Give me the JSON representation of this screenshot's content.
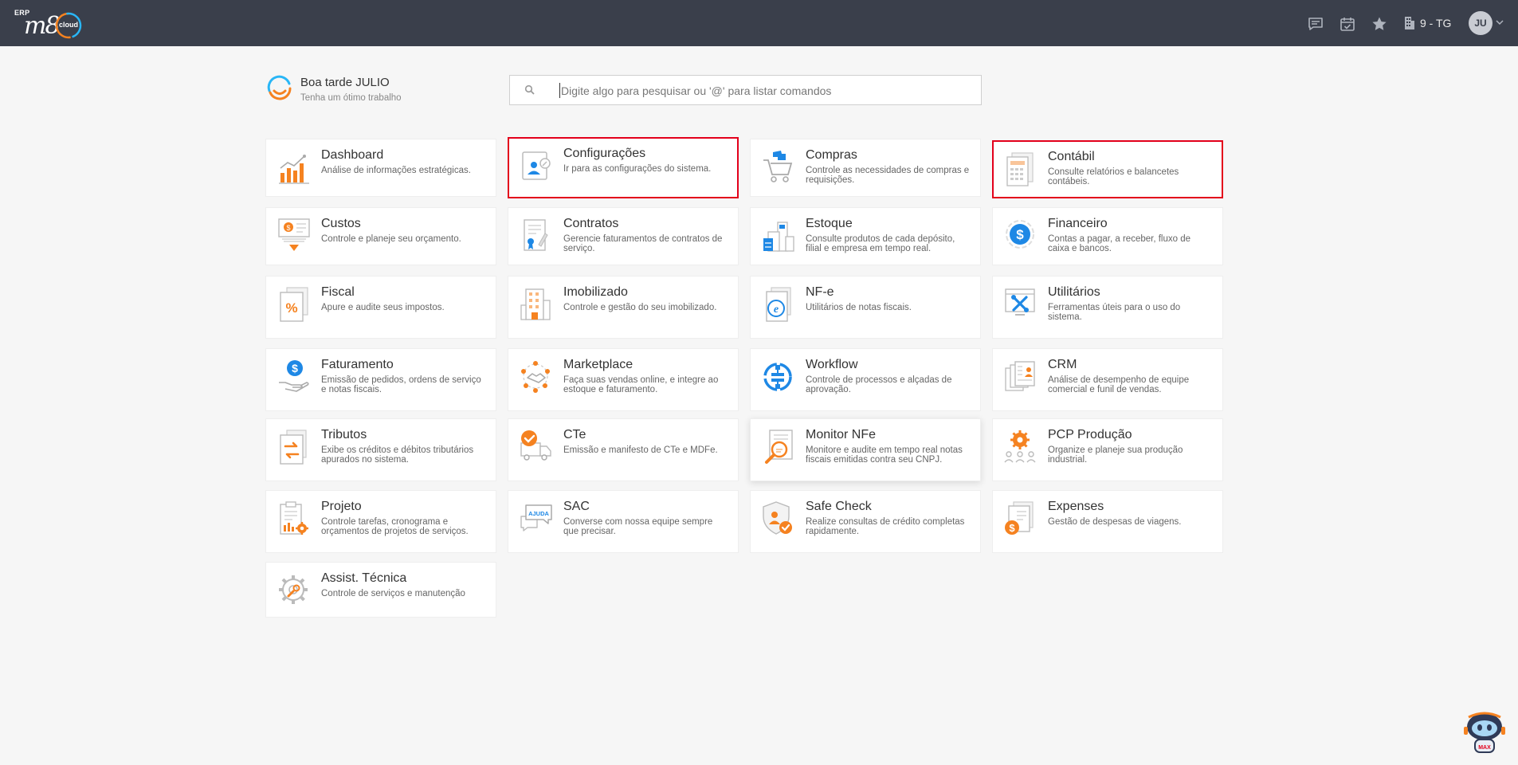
{
  "header": {
    "logo_erp": "ERP",
    "logo_m8": "m8",
    "logo_cloud": "cloud",
    "company": "9 - TG",
    "avatar": "JU"
  },
  "greeting": {
    "title": "Boa tarde JULIO",
    "subtitle": "Tenha um ótimo trabalho"
  },
  "search": {
    "placeholder": "Digite algo para pesquisar ou '@' para listar comandos"
  },
  "modules": [
    {
      "title": "Dashboard",
      "desc": "Análise de informações estratégicas."
    },
    {
      "title": "Configurações",
      "desc": "Ir para as configurações do sistema."
    },
    {
      "title": "Compras",
      "desc": "Controle as necessidades de compras e requisições."
    },
    {
      "title": "Contábil",
      "desc": "Consulte relatórios e balancetes contábeis."
    },
    {
      "title": "Custos",
      "desc": "Controle e planeje seu orçamento."
    },
    {
      "title": "Contratos",
      "desc": "Gerencie faturamentos de contratos de serviço."
    },
    {
      "title": "Estoque",
      "desc": "Consulte produtos de cada depósito, filial e empresa em tempo real."
    },
    {
      "title": "Financeiro",
      "desc": "Contas a pagar, a receber, fluxo de caixa e bancos."
    },
    {
      "title": "Fiscal",
      "desc": "Apure e audite seus impostos."
    },
    {
      "title": "Imobilizado",
      "desc": "Controle e gestão do seu imobilizado."
    },
    {
      "title": "NF-e",
      "desc": "Utilitários de notas fiscais."
    },
    {
      "title": "Utilitários",
      "desc": "Ferramentas úteis para o uso do sistema."
    },
    {
      "title": "Faturamento",
      "desc": "Emissão de pedidos, ordens de serviço e notas fiscais."
    },
    {
      "title": "Marketplace",
      "desc": "Faça suas vendas online, e integre ao estoque e faturamento."
    },
    {
      "title": "Workflow",
      "desc": "Controle de processos e alçadas de aprovação."
    },
    {
      "title": "CRM",
      "desc": "Análise de desempenho de equipe comercial e funil de vendas."
    },
    {
      "title": "Tributos",
      "desc": "Exibe os créditos e débitos tributários apurados no sistema."
    },
    {
      "title": "CTe",
      "desc": "Emissão e manifesto de CTe e MDFe."
    },
    {
      "title": "Monitor NFe",
      "desc": "Monitore e audite em tempo real notas fiscais emitidas contra seu CNPJ."
    },
    {
      "title": "PCP Produção",
      "desc": "Organize e planeje sua produção industrial."
    },
    {
      "title": "Projeto",
      "desc": "Controle tarefas, cronograma e orçamentos de projetos de serviços."
    },
    {
      "title": "SAC",
      "desc": "Converse com nossa equipe sempre que precisar."
    },
    {
      "title": "Safe Check",
      "desc": "Realize consultas de crédito completas rapidamente."
    },
    {
      "title": "Expenses",
      "desc": "Gestão de despesas de viagens."
    },
    {
      "title": "Assist. Técnica",
      "desc": "Controle de serviços e manutenção"
    }
  ],
  "icons": {
    "chat": "chat-icon",
    "calendar": "calendar-check-icon",
    "favorites": "star-icon",
    "company": "building-icon",
    "search": "search-icon",
    "assistant": "robot-assistant-icon"
  },
  "robot_badge": "MAX",
  "colors": {
    "topbar": "#3a3f4b",
    "accent_orange": "#f58220",
    "accent_blue": "#1e88e5",
    "highlight_red": "#e3001b"
  }
}
